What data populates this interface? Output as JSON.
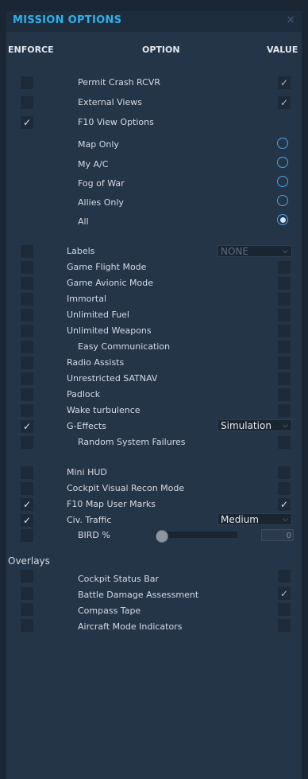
{
  "window": {
    "title": "MISSION OPTIONS",
    "close_glyph": "×"
  },
  "headers": {
    "enforce": "ENFORCE",
    "option": "OPTION",
    "value": "VALUE"
  },
  "options": {
    "permit_crash": "Permit Crash RCVR",
    "external_views": "External Views",
    "f10_view_options": "F10 View Options",
    "map_only": "Map Only",
    "my_ac": "My A/C",
    "fog_of_war": "Fog of War",
    "allies_only": "Allies Only",
    "all": "All",
    "labels": "Labels",
    "game_flight_mode": "Game Flight Mode",
    "game_avionic_mode": "Game Avionic Mode",
    "immortal": "Immortal",
    "unlimited_fuel": "Unlimited Fuel",
    "unlimited_weapons": "Unlimited Weapons",
    "easy_communication": "Easy Communication",
    "radio_assists": "Radio Assists",
    "unrestricted_satnav": "Unrestricted SATNAV",
    "padlock": "Padlock",
    "wake_turbulence": "Wake turbulence",
    "g_effects": "G-Effects",
    "random_system_failures": "Random System Failures",
    "mini_hud": "Mini HUD",
    "cockpit_visual_recon": "Cockpit Visual Recon Mode",
    "f10_map_user_marks": "F10 Map User Marks",
    "civ_traffic": "Civ. Traffic",
    "bird_pct": "BIRD %",
    "overlays": "Overlays",
    "cockpit_status_bar": "Cockpit Status Bar",
    "battle_damage_assessment": "Battle Damage Assessment",
    "compass_tape": "Compass Tape",
    "aircraft_mode_indicators": "Aircraft Mode Indicators"
  },
  "values": {
    "labels": "NONE",
    "g_effects": "Simulation",
    "civ_traffic": "Medium",
    "bird_pct": "0",
    "selected_view": "All",
    "check_glyph": "✓",
    "dropdown_glyph": "⌵"
  }
}
